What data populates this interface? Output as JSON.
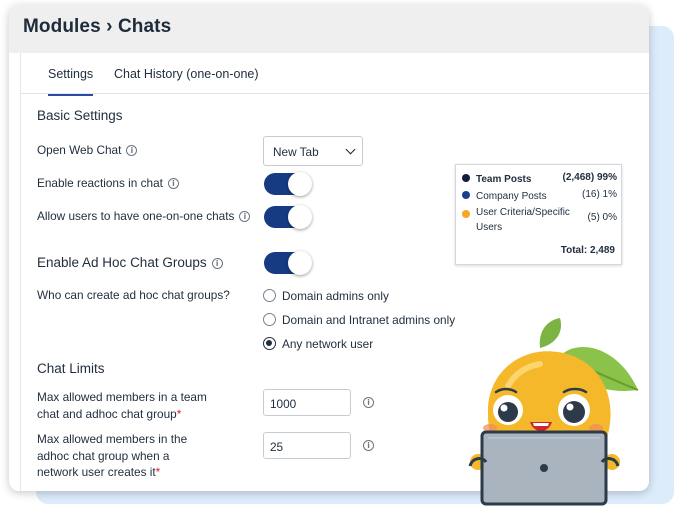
{
  "header": {
    "title": "Modules › Chats"
  },
  "tabs": [
    {
      "label": "Settings",
      "active": true
    },
    {
      "label": "Chat History (one-on-one)",
      "active": false
    }
  ],
  "basic_settings": {
    "title": "Basic Settings",
    "open_web_chat": {
      "label": "Open Web Chat",
      "value": "New Tab"
    },
    "enable_reactions": {
      "label": "Enable reactions in chat",
      "on": true
    },
    "one_on_one": {
      "label": "Allow users to have one-on-one chats",
      "on": true
    }
  },
  "adhoc": {
    "label": "Enable Ad Hoc Chat Groups",
    "on": true,
    "question": "Who can create ad hoc chat groups?",
    "options": [
      {
        "label": "Domain admins only",
        "checked": false
      },
      {
        "label": "Domain and Intranet admins only",
        "checked": false
      },
      {
        "label": "Any network user",
        "checked": true
      }
    ]
  },
  "chat_limits": {
    "title": "Chat Limits",
    "max_team": {
      "label_line1": "Max allowed members in a team",
      "label_line2": "chat and adhoc chat group",
      "required": "*",
      "value": "1000"
    },
    "max_adhoc": {
      "label_line1": "Max allowed members in the",
      "label_line2": "adhoc chat group when a",
      "label_line3": "network user creates it",
      "required": "*",
      "value": "25"
    }
  },
  "tooltip": {
    "rows": [
      {
        "name": "Team Posts",
        "value": "(2,468) 99%",
        "color": "#0f1e3d",
        "bold": true
      },
      {
        "name": "Company Posts",
        "value": "(16) 1%",
        "color": "#1b3f8f",
        "bold": false
      },
      {
        "name_line1": "User Criteria/Specific",
        "name_line2": "Users",
        "value": "(5) 0%",
        "color": "#f5a623",
        "bold": false
      }
    ],
    "total": "Total: 2,489"
  },
  "icons": {
    "info": "info-circle-icon",
    "chevron": "chevron-down-icon",
    "mascot": "mango-laptop-mascot"
  },
  "colors": {
    "toggle_on": "#163b82",
    "tab_underline": "#2b4aa8",
    "required": "#d0252f",
    "bg_panel": "#dcecfb"
  }
}
